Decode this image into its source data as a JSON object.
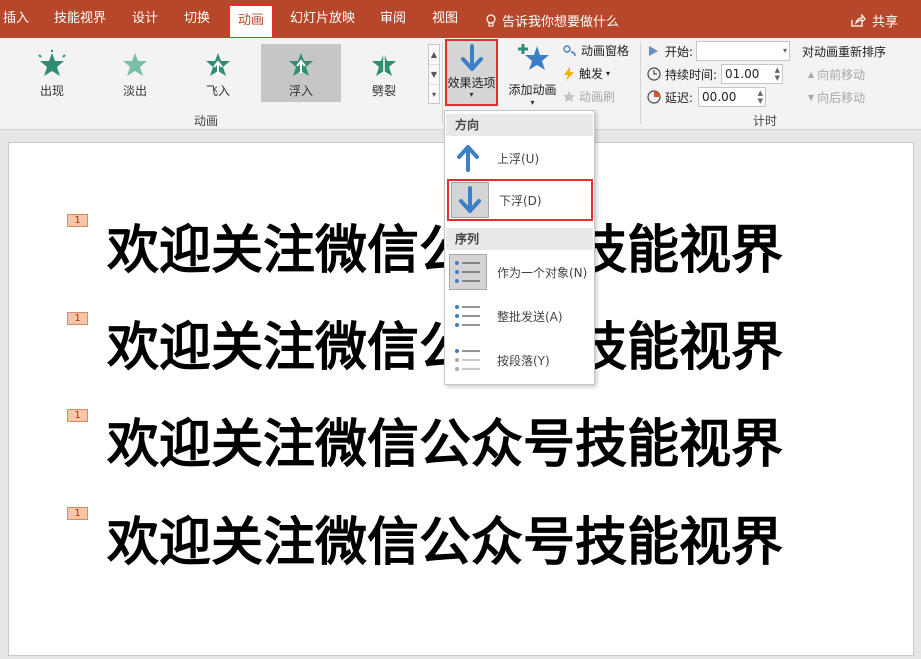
{
  "tabs": [
    {
      "label": "插入"
    },
    {
      "label": "技能视界"
    },
    {
      "label": "设计"
    },
    {
      "label": "切换"
    },
    {
      "label": "动画"
    },
    {
      "label": "幻灯片放映"
    },
    {
      "label": "审阅"
    },
    {
      "label": "视图"
    }
  ],
  "tell_me": "告诉我你想要做什么",
  "share": "共享",
  "animations": {
    "group_label": "动画",
    "items": [
      {
        "label": "出现"
      },
      {
        "label": "淡出"
      },
      {
        "label": "飞入"
      },
      {
        "label": "浮入"
      },
      {
        "label": "劈裂"
      }
    ],
    "selected": "浮入"
  },
  "effect_options": {
    "label": "效果选项"
  },
  "add_animation": {
    "label": "添加动画"
  },
  "advanced": {
    "pane": "动画窗格",
    "trigger": "触发",
    "painter": "动画刷"
  },
  "timing": {
    "group_label": "计时",
    "start_label": "开始:",
    "start_value": "",
    "duration_label": "持续时间:",
    "duration_value": "01.00",
    "delay_label": "延迟:",
    "delay_value": "00.00",
    "reorder_label": "对动画重新排序",
    "move_earlier": "向前移动",
    "move_later": "向后移动"
  },
  "slide": {
    "badges": [
      "1",
      "1",
      "1",
      "1"
    ],
    "lines": [
      "欢迎关注微信公众号技能视界",
      "欢迎关注微信公众号技能视界",
      "欢迎关注微信公众号技能视界",
      "欢迎关注微信公众号技能视界"
    ]
  },
  "dropdown": {
    "direction_header": "方向",
    "float_up": "上浮(U)",
    "float_down": "下浮(D)",
    "sequence_header": "序列",
    "as_one_object": "作为一个对象(N)",
    "all_at_once": "整批发送(A)",
    "by_paragraph": "按段落(Y)"
  },
  "colors": {
    "accent": "#b7472a",
    "highlight_box": "#e03030",
    "arrow_blue": "#3c7fc6",
    "star_green": "#2f8d73"
  }
}
